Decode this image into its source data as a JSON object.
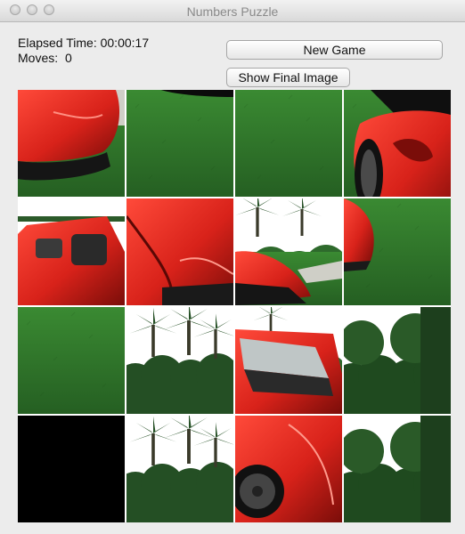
{
  "window": {
    "title": "Numbers Puzzle"
  },
  "status": {
    "elapsed_label": "Elapsed Time:",
    "elapsed_value": "00:00:17",
    "moves_label": "Moves:",
    "moves_value": "0"
  },
  "buttons": {
    "new_game": "New Game",
    "show_final": "Show Final Image"
  },
  "board": {
    "rows": 4,
    "cols": 4,
    "tiles": [
      {
        "row": 0,
        "col": 0,
        "content": "car-front-left",
        "empty": false
      },
      {
        "row": 0,
        "col": 1,
        "content": "grass-shadow",
        "empty": false
      },
      {
        "row": 0,
        "col": 2,
        "content": "grass",
        "empty": false
      },
      {
        "row": 0,
        "col": 3,
        "content": "car-right-side",
        "empty": false
      },
      {
        "row": 1,
        "col": 0,
        "content": "car-cockpit",
        "empty": false
      },
      {
        "row": 1,
        "col": 1,
        "content": "car-hood-closeup",
        "empty": false
      },
      {
        "row": 1,
        "col": 2,
        "content": "car-nose-trees",
        "empty": false
      },
      {
        "row": 1,
        "col": 3,
        "content": "grass-car-edge",
        "empty": false
      },
      {
        "row": 2,
        "col": 0,
        "content": "grass",
        "empty": false
      },
      {
        "row": 2,
        "col": 1,
        "content": "palm-trees",
        "empty": false
      },
      {
        "row": 2,
        "col": 2,
        "content": "car-windshield",
        "empty": false
      },
      {
        "row": 2,
        "col": 3,
        "content": "trees-forest",
        "empty": false
      },
      {
        "row": 3,
        "col": 0,
        "content": "empty",
        "empty": true
      },
      {
        "row": 3,
        "col": 1,
        "content": "palm-trees",
        "empty": false
      },
      {
        "row": 3,
        "col": 2,
        "content": "car-wheel",
        "empty": false
      },
      {
        "row": 3,
        "col": 3,
        "content": "trees-forest",
        "empty": false
      }
    ]
  },
  "colors": {
    "car_red": "#d8221a",
    "grass": "#2f7a2a",
    "tree_dark": "#244f24",
    "sky": "#ffffff",
    "empty": "#000000"
  }
}
